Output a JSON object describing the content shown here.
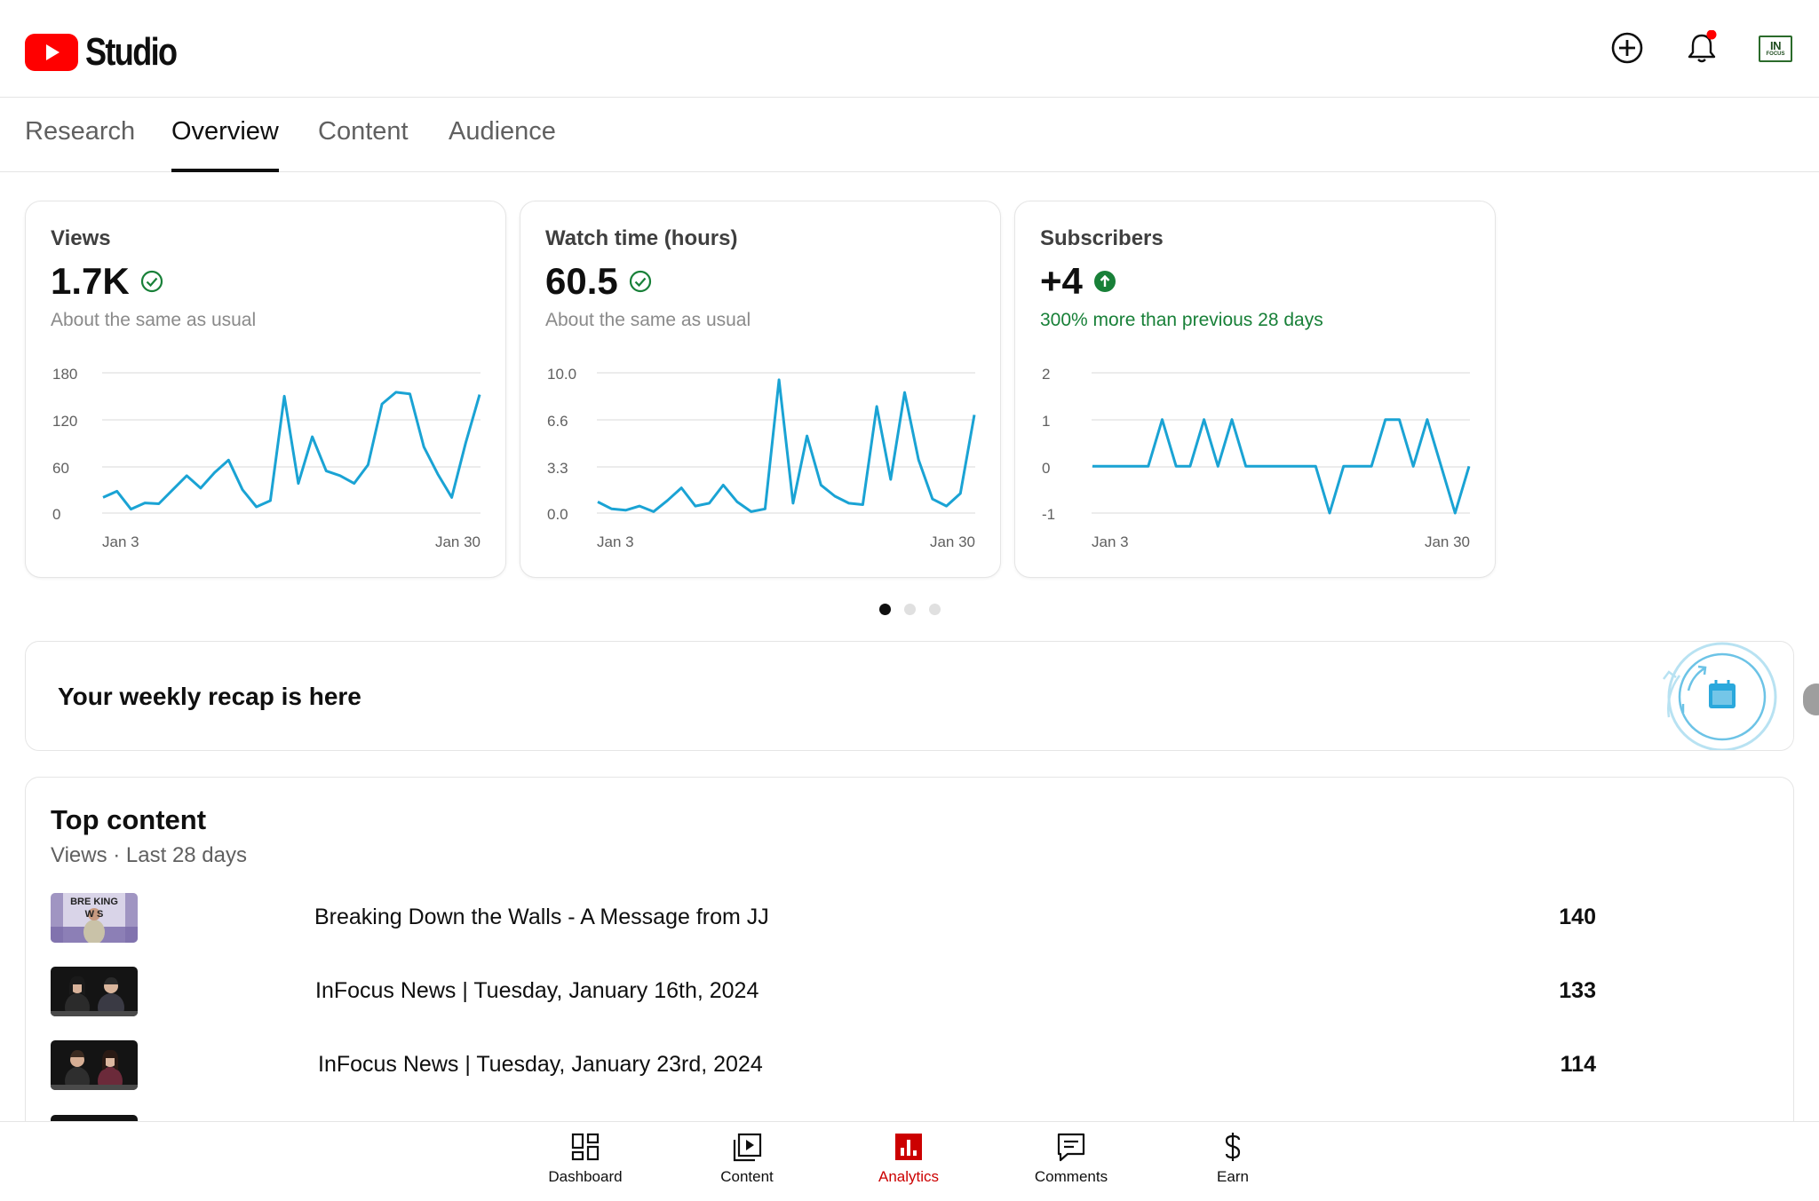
{
  "header": {
    "app_name": "Studio",
    "create_icon": "plus-circle-icon",
    "notifications_icon": "bell-icon",
    "avatar_line1": "IN",
    "avatar_line2": "FOCUS"
  },
  "tabs": [
    {
      "label": "Research",
      "active": false
    },
    {
      "label": "Overview",
      "active": true
    },
    {
      "label": "Content",
      "active": false
    },
    {
      "label": "Audience",
      "active": false
    }
  ],
  "metrics": [
    {
      "title": "Views",
      "value": "1.7K",
      "status_icon": "check-circle-icon",
      "subtitle": "About the same as usual",
      "chart_data": {
        "type": "line",
        "y_ticks": [
          "180",
          "120",
          "60",
          "0"
        ],
        "ylim": [
          0,
          180
        ],
        "x_tick_labels": [
          "Jan 3",
          "Jan 30"
        ],
        "color": "#1aa3d4",
        "values": [
          20,
          28,
          5,
          13,
          12,
          30,
          48,
          32,
          52,
          68,
          30,
          8,
          16,
          150,
          38,
          98,
          54,
          48,
          38,
          62,
          140,
          155,
          153,
          85,
          50,
          20,
          90,
          152
        ]
      }
    },
    {
      "title": "Watch time (hours)",
      "value": "60.5",
      "status_icon": "check-circle-icon",
      "subtitle": "About the same as usual",
      "chart_data": {
        "type": "line",
        "y_ticks": [
          "10.0",
          "6.6",
          "3.3",
          "0.0"
        ],
        "ylim": [
          0,
          10
        ],
        "x_tick_labels": [
          "Jan 3",
          "Jan 30"
        ],
        "color": "#1aa3d4",
        "values": [
          0.8,
          0.3,
          0.2,
          0.5,
          0.1,
          0.9,
          1.8,
          0.5,
          0.7,
          2.0,
          0.8,
          0.1,
          0.3,
          9.5,
          0.7,
          5.5,
          2.0,
          1.2,
          0.7,
          0.6,
          7.6,
          2.4,
          8.6,
          3.8,
          1.0,
          0.5,
          1.4,
          7.0
        ]
      }
    },
    {
      "title": "Subscribers",
      "value": "+4",
      "status_icon": "arrow-up-circle-icon",
      "subtitle": "300% more than previous 28 days",
      "subtitle_color": "#188038",
      "chart_data": {
        "type": "line",
        "y_ticks": [
          "2",
          "1",
          "0",
          "-1"
        ],
        "ylim": [
          -1,
          2
        ],
        "x_tick_labels": [
          "Jan 3",
          "Jan 30"
        ],
        "color": "#1aa3d4",
        "values": [
          0,
          0,
          0,
          0,
          0,
          1,
          0,
          0,
          1,
          0,
          1,
          0,
          0,
          0,
          0,
          0,
          0,
          -1,
          0,
          0,
          0,
          1,
          1,
          0,
          1,
          0,
          -1,
          0
        ]
      }
    }
  ],
  "pager": {
    "count": 3,
    "active": 0
  },
  "recap": {
    "title": "Your weekly recap is here",
    "icon": "calendar-icon"
  },
  "top_content": {
    "title": "Top content",
    "subtitle": "Views · Last 28 days",
    "rows": [
      {
        "title": "Breaking Down the Walls - A Message from JJ",
        "views": "140",
        "thumb_text": "BREAKING WALLS"
      },
      {
        "title": "InFocus News | Tuesday, January 16th, 2024",
        "views": "133"
      },
      {
        "title": "InFocus News | Tuesday, January 23rd, 2024",
        "views": "114"
      }
    ]
  },
  "bottom_nav": [
    {
      "label": "Dashboard",
      "icon": "dashboard-icon",
      "active": false
    },
    {
      "label": "Content",
      "icon": "content-icon",
      "active": false
    },
    {
      "label": "Analytics",
      "icon": "analytics-icon",
      "active": true
    },
    {
      "label": "Comments",
      "icon": "comments-icon",
      "active": false
    },
    {
      "label": "Earn",
      "icon": "dollar-icon",
      "active": false
    }
  ],
  "colors": {
    "brand_red": "#ff0000",
    "active_red": "#cc0000",
    "chart_line": "#1aa3d4",
    "positive_green": "#188038"
  }
}
